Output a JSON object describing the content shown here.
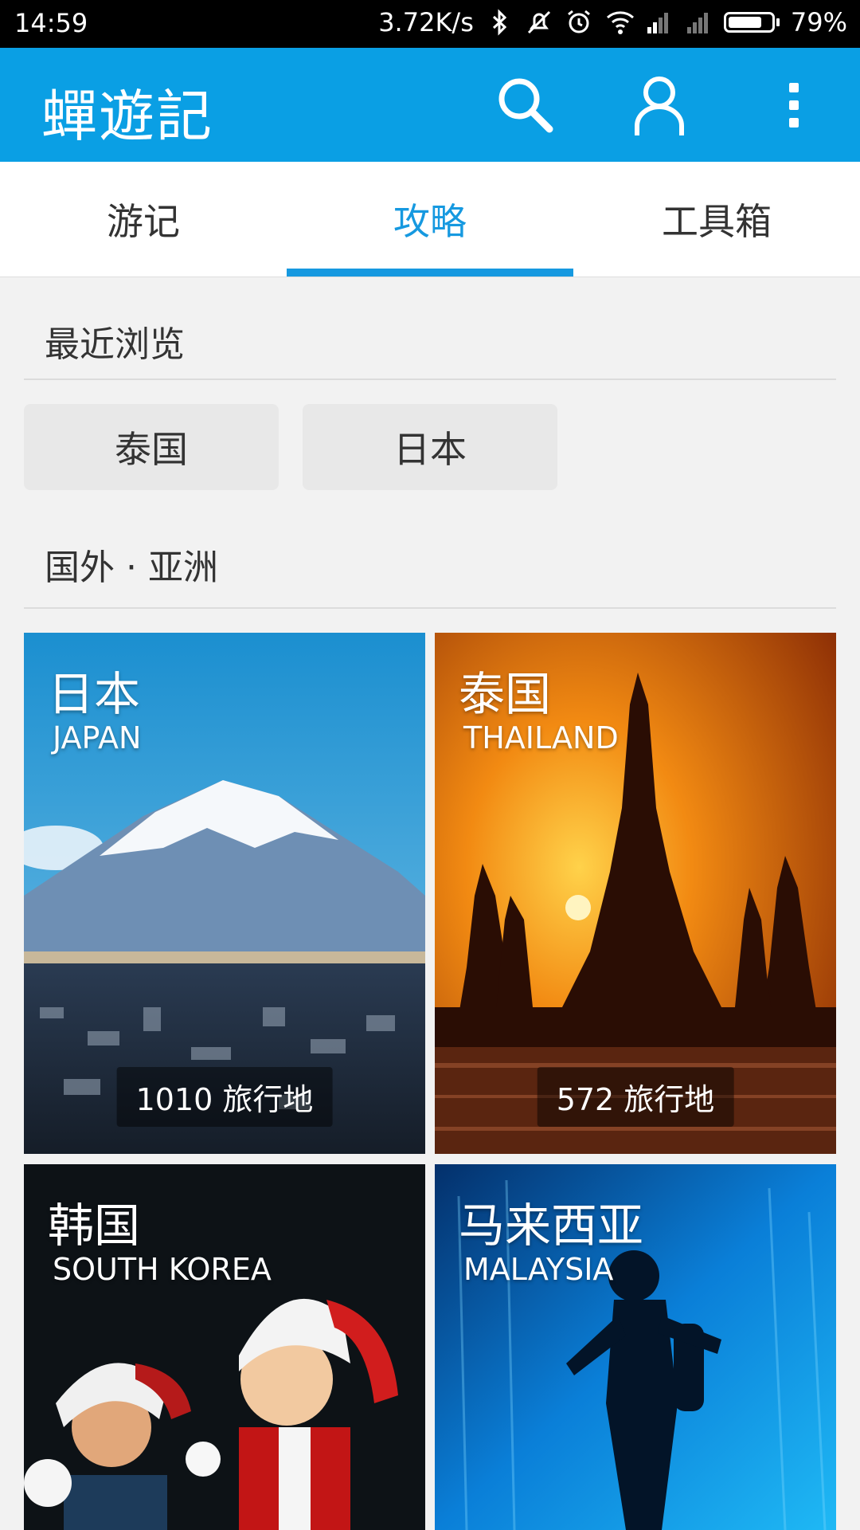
{
  "status_bar": {
    "time": "14:59",
    "speed": "3.72K/s",
    "battery_pct": "79%",
    "battery_level": 0.79,
    "icons": [
      "bluetooth-icon",
      "mute-icon",
      "alarm-icon",
      "wifi-icon",
      "signal-icon",
      "signal-icon",
      "battery-icon"
    ]
  },
  "app_bar": {
    "title": "蟬遊記",
    "icons": [
      "search-icon",
      "user-icon",
      "more-vert-icon"
    ],
    "color": "#0a9fe4"
  },
  "tabs": [
    {
      "label": "游记",
      "active": false
    },
    {
      "label": "攻略",
      "active": true
    },
    {
      "label": "工具箱",
      "active": false
    }
  ],
  "recent": {
    "title": "最近浏览",
    "chips": [
      "泰国",
      "日本"
    ]
  },
  "asia": {
    "title": "国外 · 亚洲",
    "cards": [
      {
        "name_cn": "日本",
        "name_en": "JAPAN",
        "count": "1010 旅行地"
      },
      {
        "name_cn": "泰国",
        "name_en": "THAILAND",
        "count": "572 旅行地"
      },
      {
        "name_cn": "韩国",
        "name_en": "SOUTH KOREA",
        "count": ""
      },
      {
        "name_cn": "马来西亚",
        "name_en": "MALAYSIA",
        "count": ""
      }
    ]
  },
  "accent_color": "#1699e0"
}
